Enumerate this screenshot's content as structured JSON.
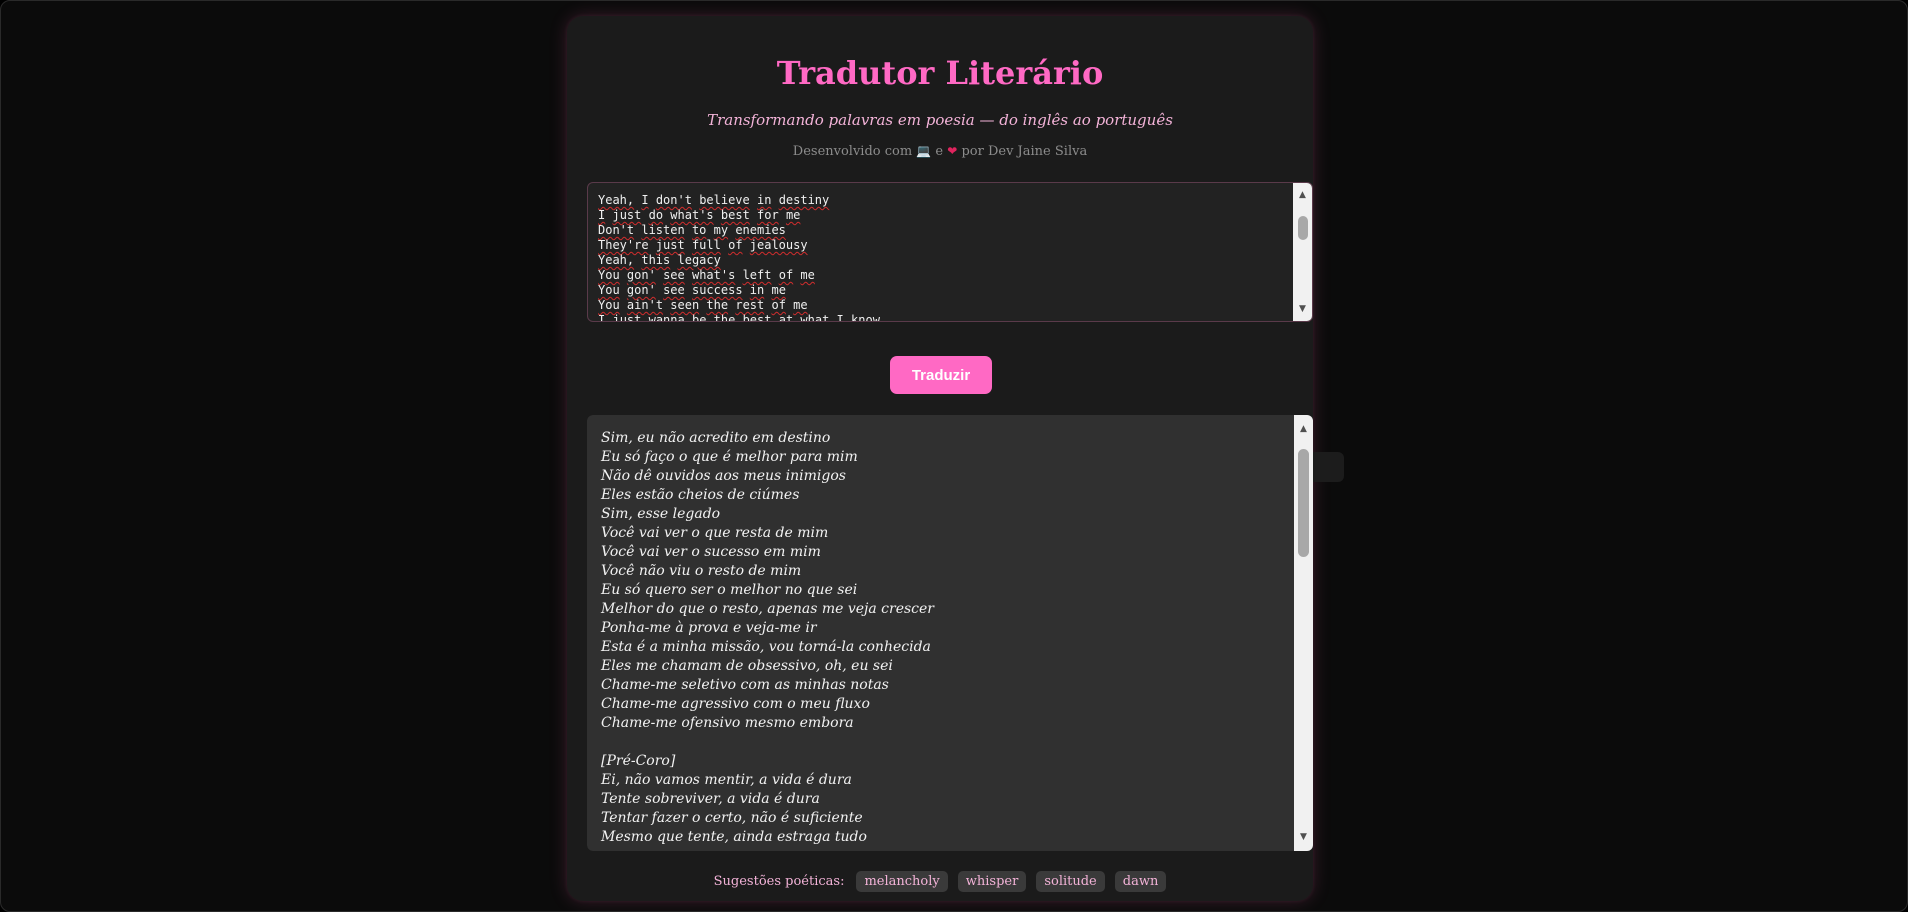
{
  "header": {
    "title": "Tradutor Literário",
    "subtitle": "Transformando palavras em poesia — do inglês ao português",
    "credits_prefix": "Desenvolvido com",
    "credits_laptop": "💻",
    "credits_and": "e",
    "credits_heart": "❤",
    "credits_suffix": "por Dev Jaine Silva"
  },
  "input": {
    "lines": [
      "Yeah, I don't believe in destiny",
      "I just do what's best for me",
      "Don't listen to my enemies",
      "They're just full of jealousy",
      "Yeah, this legacy",
      "You gon' see what's left of me",
      "You gon' see success in me",
      "You ain't seen the rest of me",
      "I just wanna be the best at what I know"
    ]
  },
  "translate_button": {
    "label": "Traduzir"
  },
  "output": {
    "lines": [
      "Sim, eu não acredito em destino",
      "Eu só faço o que é melhor para mim",
      "Não dê ouvidos aos meus inimigos",
      "Eles estão cheios de ciúmes",
      "Sim, esse legado",
      "Você vai ver o que resta de mim",
      "Você vai ver o sucesso em mim",
      "Você não viu o resto de mim",
      "Eu só quero ser o melhor no que sei",
      "Melhor do que o resto, apenas me veja crescer",
      "Ponha-me à prova e veja-me ir",
      "Esta é a minha missão, vou torná-la conhecida",
      "Eles me chamam de obsessivo, oh, eu sei",
      "Chame-me seletivo com as minhas notas",
      "Chame-me agressivo com o meu fluxo",
      "Chame-me ofensivo mesmo embora",
      "",
      "[Pré-Coro]",
      "Ei, não vamos mentir, a vida é dura",
      "Tente sobreviver, a vida é dura",
      "Tentar fazer o certo, não é suficiente",
      "Mesmo que tente, ainda estraga tudo"
    ]
  },
  "suggestions": {
    "label": "Sugestões poéticas:",
    "chips": [
      "melancholy",
      "whisper",
      "solitude",
      "dawn"
    ]
  },
  "colors": {
    "accent": "#ff69c4",
    "subtitle": "#f3b3d8",
    "background": "#0b0b0b",
    "card": "#1b1b1b"
  },
  "icons": {
    "scroll_up": "triangle-up-icon",
    "scroll_down": "triangle-down-icon"
  }
}
